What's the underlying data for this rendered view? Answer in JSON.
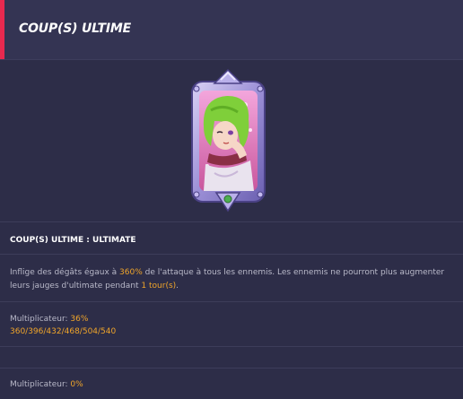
{
  "header": {
    "title": "COUP(S) ULTIME",
    "accent_color": "#e8294f"
  },
  "portrait": {
    "icon": "character-portrait-icon",
    "frame_color": "#9b8fd6",
    "background_color": "#e58ac8"
  },
  "skill": {
    "name": "COUP(S) ULTIME : ULTIMATE",
    "description": {
      "part1": "Inflige des dégâts égaux à ",
      "value1": "360%",
      "part2": " de l'attaque à tous les ennemis. Les ennemis ne pourront plus augmenter leurs jauges d'ultimate pendant ",
      "value2": "1 tour(s)",
      "part3": "."
    }
  },
  "multipliers": [
    {
      "label": "Multiplicateur: ",
      "value": "36%",
      "levels": "360/396/432/468/504/540"
    },
    {
      "label": "Multiplicateur: ",
      "value": "0%"
    }
  ],
  "colors": {
    "highlight": "#f0a52a",
    "background": "#2d2d48"
  }
}
